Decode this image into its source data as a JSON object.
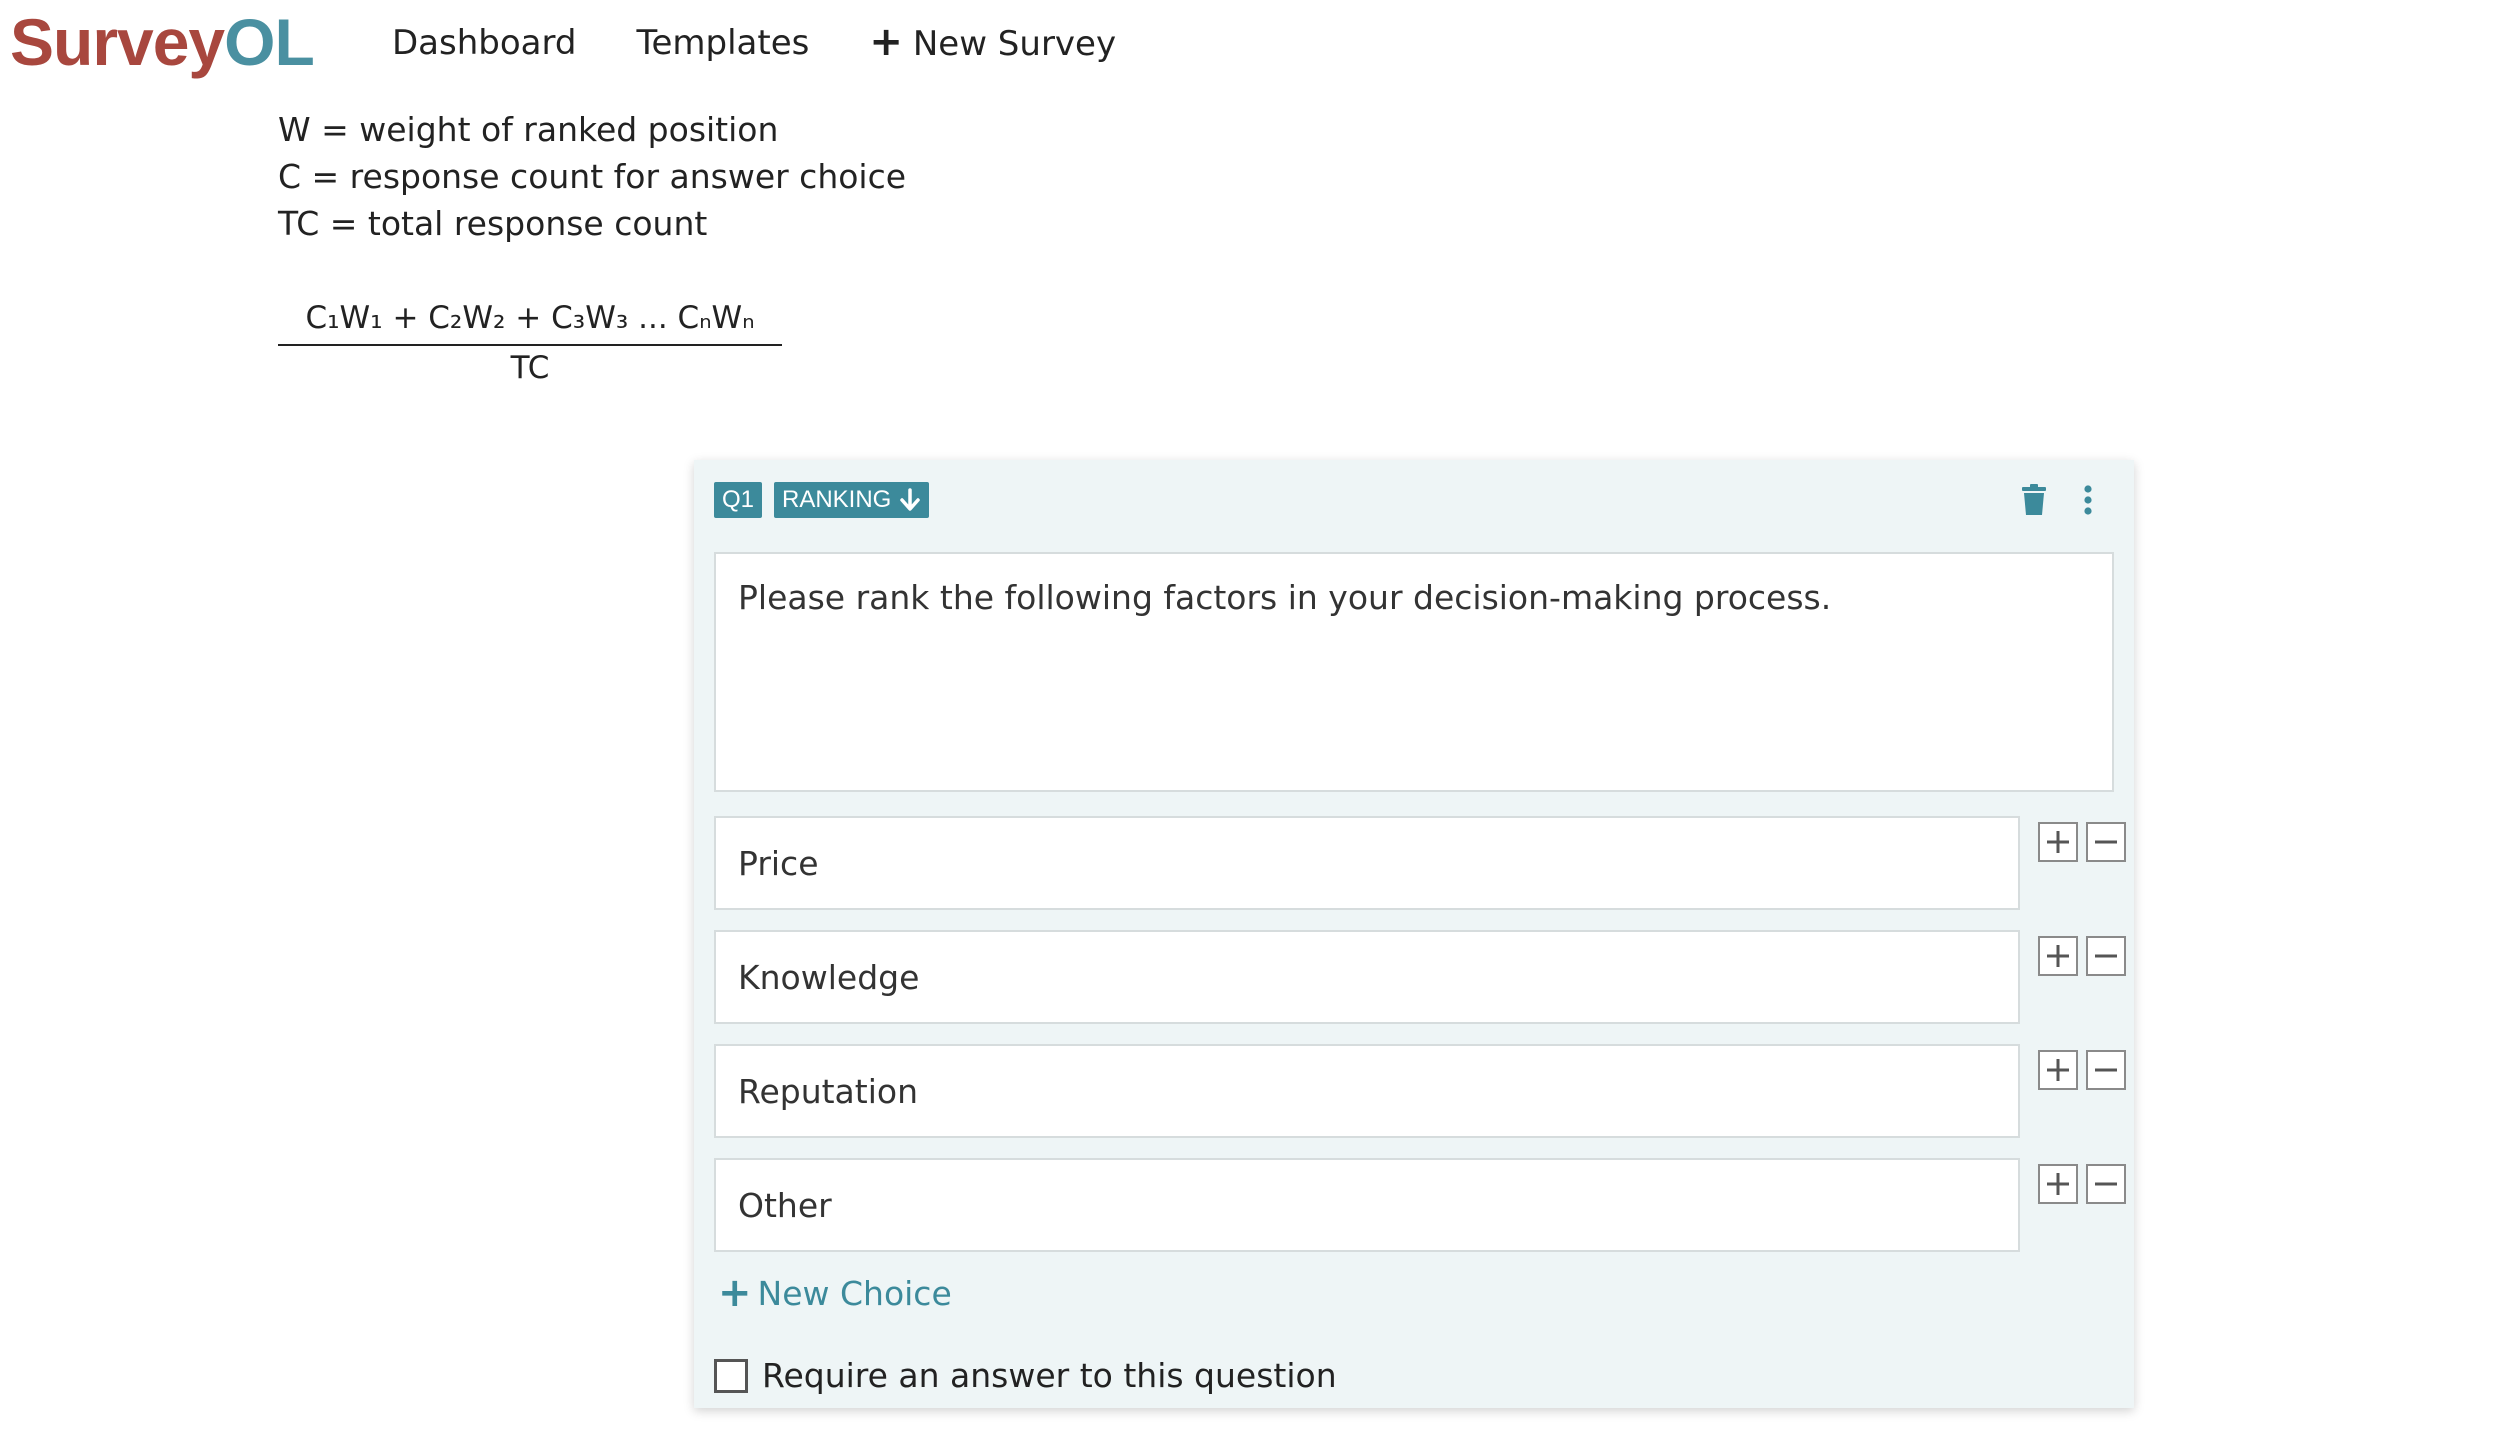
{
  "app": {
    "logo_part1": "Survey",
    "logo_part2": "OL"
  },
  "nav": {
    "dashboard": "Dashboard",
    "templates": "Templates",
    "new_survey": "New Survey"
  },
  "legend": {
    "w_line": "W = weight of ranked position",
    "c_line": "C = response count for answer choice",
    "tc_line": "TC = total response count"
  },
  "formula": {
    "numerator": "C₁W₁ + C₂W₂ + C₃W₃ ... CₙWₙ",
    "denominator": "TC"
  },
  "question": {
    "number_badge": "Q1",
    "type_badge": "RANKING",
    "text": "Please rank the following factors in your decision-making process.",
    "choices": [
      {
        "label": "Price"
      },
      {
        "label": "Knowledge"
      },
      {
        "label": "Reputation"
      },
      {
        "label": "Other"
      }
    ],
    "new_choice_label": "New Choice",
    "require_label": "Require an answer to this question",
    "require_checked": false
  },
  "colors": {
    "accent": "#3c8a9b",
    "logo_red": "#a8473e",
    "logo_teal": "#4a90a1",
    "card_bg": "#eef5f6"
  },
  "icons": {
    "trash": "trash-icon",
    "more": "more-vertical-icon",
    "add": "plus-icon",
    "remove": "minus-icon",
    "dropdown": "arrow-down-icon"
  }
}
